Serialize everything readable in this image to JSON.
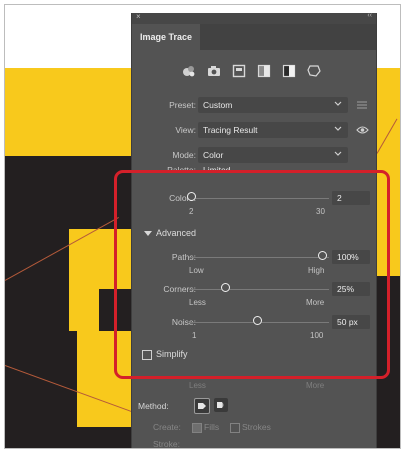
{
  "panel": {
    "title": "Image Trace",
    "presets_icons": [
      "auto-color-icon",
      "high-color-icon",
      "low-color-icon",
      "grayscale-icon",
      "black-white-icon",
      "outline-icon"
    ],
    "preset": {
      "label": "Preset:",
      "value": "Custom"
    },
    "view": {
      "label": "View:",
      "value": "Tracing Result"
    },
    "mode": {
      "label": "Mode:",
      "value": "Color"
    },
    "palette": {
      "label": "Palette:",
      "value": "Limited"
    },
    "colors": {
      "label": "Colors:",
      "value": "2",
      "min": "2",
      "max": "30",
      "level": 0.0
    },
    "advanced": {
      "label": "Advanced"
    },
    "paths": {
      "label": "Paths:",
      "value": "100%",
      "min": "Low",
      "max": "High",
      "level": 1.0
    },
    "corners": {
      "label": "Corners:",
      "value": "25%",
      "min": "Less",
      "max": "More",
      "level": 0.25
    },
    "noise": {
      "label": "Noise:",
      "value": "50 px",
      "min": "1",
      "max": "100",
      "level": 0.5
    },
    "simplify": {
      "label": "Simplify",
      "checked": false
    },
    "less_more": {
      "min": "Less",
      "max": "More"
    },
    "method": {
      "label": "Method:"
    },
    "create": {
      "label": "Create:",
      "fills": "Fills",
      "strokes": "Strokes"
    },
    "stroke": {
      "label": "Stroke:"
    }
  },
  "colors": {
    "highlight": "#d4202a",
    "panel_bg": "#535353",
    "artwork_yellow": "#f8c91c",
    "artwork_black": "#231f20"
  }
}
